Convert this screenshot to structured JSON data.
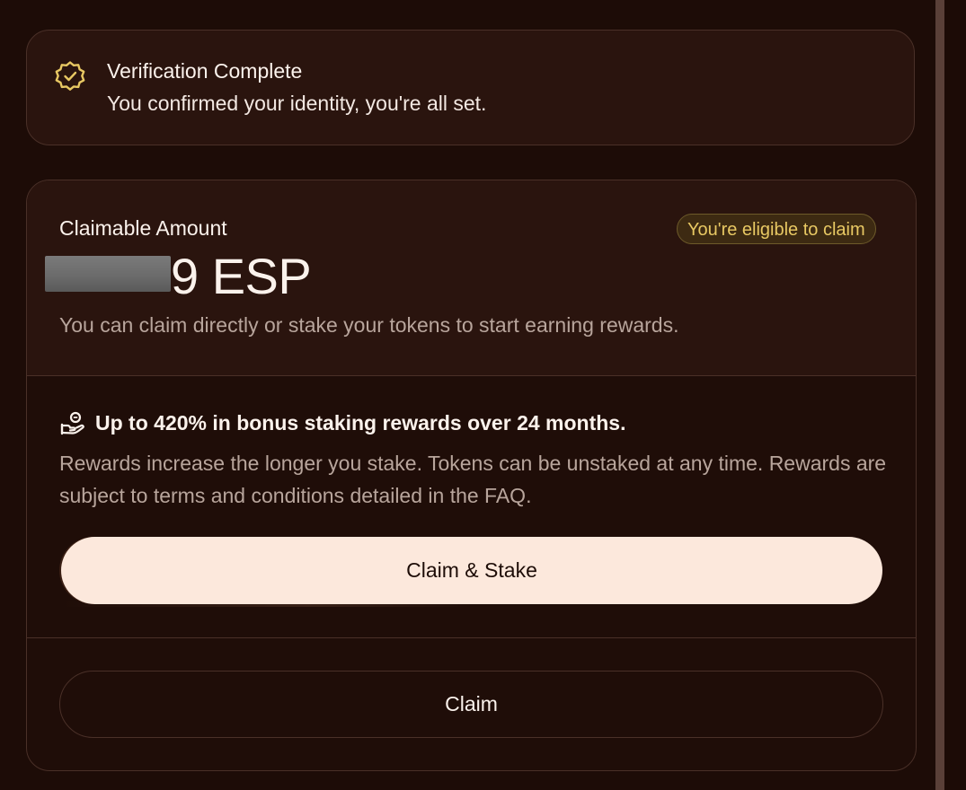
{
  "verification": {
    "icon": "verified-badge-icon",
    "title": "Verification Complete",
    "subtitle": "You confirmed your identity, you're all set."
  },
  "claim": {
    "label": "Claimable Amount",
    "eligible_badge": "You're eligible to claim",
    "amount_visible": "9 ESP",
    "description": "You can claim directly or stake your tokens to start earning rewards."
  },
  "staking": {
    "icon": "hand-coins-icon",
    "title": "Up to 420% in bonus staking rewards over 24 months.",
    "description": "Rewards increase the longer you stake. Tokens can be unstaked at any time. Rewards are subject to terms and conditions detailed in the FAQ."
  },
  "buttons": {
    "claim_stake_label": "Claim & Stake",
    "claim_label": "Claim"
  },
  "colors": {
    "background": "#1d0c07",
    "card": "#2a140e",
    "accent_gold": "#e8c863",
    "primary_button": "#fce8dc"
  }
}
